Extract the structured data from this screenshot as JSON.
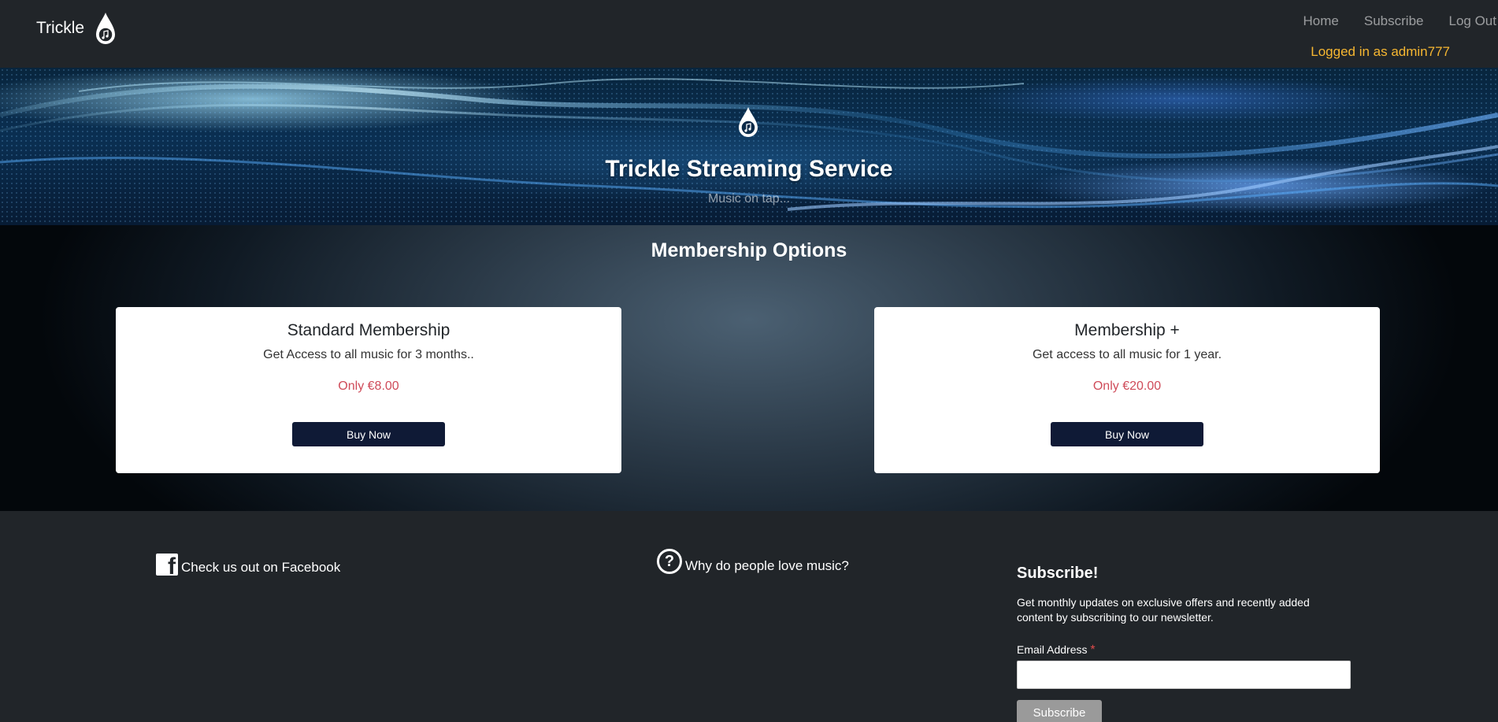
{
  "navbar": {
    "brand": "Trickle",
    "links": [
      "Home",
      "Subscribe",
      "Log Out"
    ],
    "logged_in": "Logged in as admin777"
  },
  "hero": {
    "title": "Trickle Streaming Service",
    "subtitle": "Music on tap..."
  },
  "membership": {
    "title": "Membership Options",
    "plans": [
      {
        "name": "Standard Membership",
        "description": "Get Access to all music for 3 months..",
        "price": "Only €8.00",
        "button": "Buy Now"
      },
      {
        "name": "Membership +",
        "description": "Get access to all music for 1 year.",
        "price": "Only €20.00",
        "button": "Buy Now"
      }
    ]
  },
  "footer": {
    "facebook_text": "Check us out on Facebook",
    "why_text": "Why do people love music?",
    "subscribe": {
      "title": "Subscribe!",
      "text": "Get monthly updates on exclusive offers and recently added content by subscribing to our newsletter.",
      "email_label": "Email Address",
      "required_mark": "*",
      "email_value": "",
      "button": "Subscribe"
    }
  },
  "icons": {
    "brand": "water-drop-music-note-icon",
    "facebook": "facebook-icon",
    "question": "question-circle-icon"
  },
  "colors": {
    "background": "#212529",
    "accent_user": "#f7b731",
    "price": "#cf4b59",
    "buy_button": "#0f1a36"
  }
}
